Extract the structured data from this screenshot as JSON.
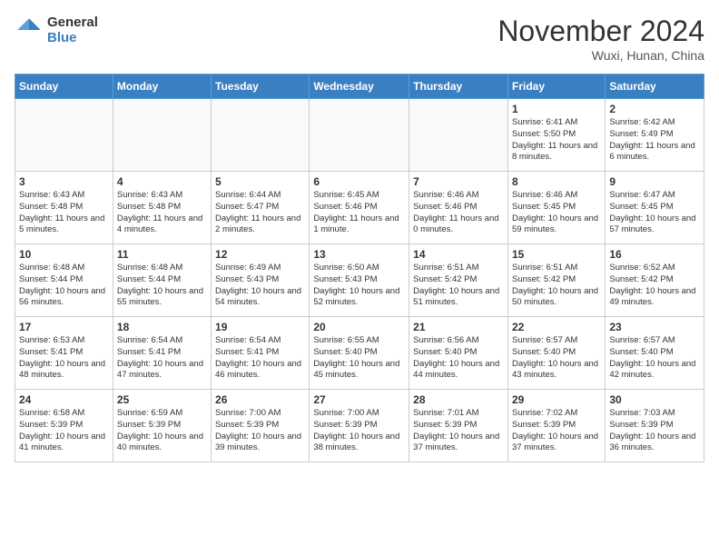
{
  "header": {
    "logo_line1": "General",
    "logo_line2": "Blue",
    "month": "November 2024",
    "location": "Wuxi, Hunan, China"
  },
  "weekdays": [
    "Sunday",
    "Monday",
    "Tuesday",
    "Wednesday",
    "Thursday",
    "Friday",
    "Saturday"
  ],
  "weeks": [
    [
      {
        "day": "",
        "info": ""
      },
      {
        "day": "",
        "info": ""
      },
      {
        "day": "",
        "info": ""
      },
      {
        "day": "",
        "info": ""
      },
      {
        "day": "",
        "info": ""
      },
      {
        "day": "1",
        "info": "Sunrise: 6:41 AM\nSunset: 5:50 PM\nDaylight: 11 hours\nand 8 minutes."
      },
      {
        "day": "2",
        "info": "Sunrise: 6:42 AM\nSunset: 5:49 PM\nDaylight: 11 hours\nand 6 minutes."
      }
    ],
    [
      {
        "day": "3",
        "info": "Sunrise: 6:43 AM\nSunset: 5:48 PM\nDaylight: 11 hours\nand 5 minutes."
      },
      {
        "day": "4",
        "info": "Sunrise: 6:43 AM\nSunset: 5:48 PM\nDaylight: 11 hours\nand 4 minutes."
      },
      {
        "day": "5",
        "info": "Sunrise: 6:44 AM\nSunset: 5:47 PM\nDaylight: 11 hours\nand 2 minutes."
      },
      {
        "day": "6",
        "info": "Sunrise: 6:45 AM\nSunset: 5:46 PM\nDaylight: 11 hours\nand 1 minute."
      },
      {
        "day": "7",
        "info": "Sunrise: 6:46 AM\nSunset: 5:46 PM\nDaylight: 11 hours\nand 0 minutes."
      },
      {
        "day": "8",
        "info": "Sunrise: 6:46 AM\nSunset: 5:45 PM\nDaylight: 10 hours\nand 59 minutes."
      },
      {
        "day": "9",
        "info": "Sunrise: 6:47 AM\nSunset: 5:45 PM\nDaylight: 10 hours\nand 57 minutes."
      }
    ],
    [
      {
        "day": "10",
        "info": "Sunrise: 6:48 AM\nSunset: 5:44 PM\nDaylight: 10 hours\nand 56 minutes."
      },
      {
        "day": "11",
        "info": "Sunrise: 6:48 AM\nSunset: 5:44 PM\nDaylight: 10 hours\nand 55 minutes."
      },
      {
        "day": "12",
        "info": "Sunrise: 6:49 AM\nSunset: 5:43 PM\nDaylight: 10 hours\nand 54 minutes."
      },
      {
        "day": "13",
        "info": "Sunrise: 6:50 AM\nSunset: 5:43 PM\nDaylight: 10 hours\nand 52 minutes."
      },
      {
        "day": "14",
        "info": "Sunrise: 6:51 AM\nSunset: 5:42 PM\nDaylight: 10 hours\nand 51 minutes."
      },
      {
        "day": "15",
        "info": "Sunrise: 6:51 AM\nSunset: 5:42 PM\nDaylight: 10 hours\nand 50 minutes."
      },
      {
        "day": "16",
        "info": "Sunrise: 6:52 AM\nSunset: 5:42 PM\nDaylight: 10 hours\nand 49 minutes."
      }
    ],
    [
      {
        "day": "17",
        "info": "Sunrise: 6:53 AM\nSunset: 5:41 PM\nDaylight: 10 hours\nand 48 minutes."
      },
      {
        "day": "18",
        "info": "Sunrise: 6:54 AM\nSunset: 5:41 PM\nDaylight: 10 hours\nand 47 minutes."
      },
      {
        "day": "19",
        "info": "Sunrise: 6:54 AM\nSunset: 5:41 PM\nDaylight: 10 hours\nand 46 minutes."
      },
      {
        "day": "20",
        "info": "Sunrise: 6:55 AM\nSunset: 5:40 PM\nDaylight: 10 hours\nand 45 minutes."
      },
      {
        "day": "21",
        "info": "Sunrise: 6:56 AM\nSunset: 5:40 PM\nDaylight: 10 hours\nand 44 minutes."
      },
      {
        "day": "22",
        "info": "Sunrise: 6:57 AM\nSunset: 5:40 PM\nDaylight: 10 hours\nand 43 minutes."
      },
      {
        "day": "23",
        "info": "Sunrise: 6:57 AM\nSunset: 5:40 PM\nDaylight: 10 hours\nand 42 minutes."
      }
    ],
    [
      {
        "day": "24",
        "info": "Sunrise: 6:58 AM\nSunset: 5:39 PM\nDaylight: 10 hours\nand 41 minutes."
      },
      {
        "day": "25",
        "info": "Sunrise: 6:59 AM\nSunset: 5:39 PM\nDaylight: 10 hours\nand 40 minutes."
      },
      {
        "day": "26",
        "info": "Sunrise: 7:00 AM\nSunset: 5:39 PM\nDaylight: 10 hours\nand 39 minutes."
      },
      {
        "day": "27",
        "info": "Sunrise: 7:00 AM\nSunset: 5:39 PM\nDaylight: 10 hours\nand 38 minutes."
      },
      {
        "day": "28",
        "info": "Sunrise: 7:01 AM\nSunset: 5:39 PM\nDaylight: 10 hours\nand 37 minutes."
      },
      {
        "day": "29",
        "info": "Sunrise: 7:02 AM\nSunset: 5:39 PM\nDaylight: 10 hours\nand 37 minutes."
      },
      {
        "day": "30",
        "info": "Sunrise: 7:03 AM\nSunset: 5:39 PM\nDaylight: 10 hours\nand 36 minutes."
      }
    ]
  ]
}
